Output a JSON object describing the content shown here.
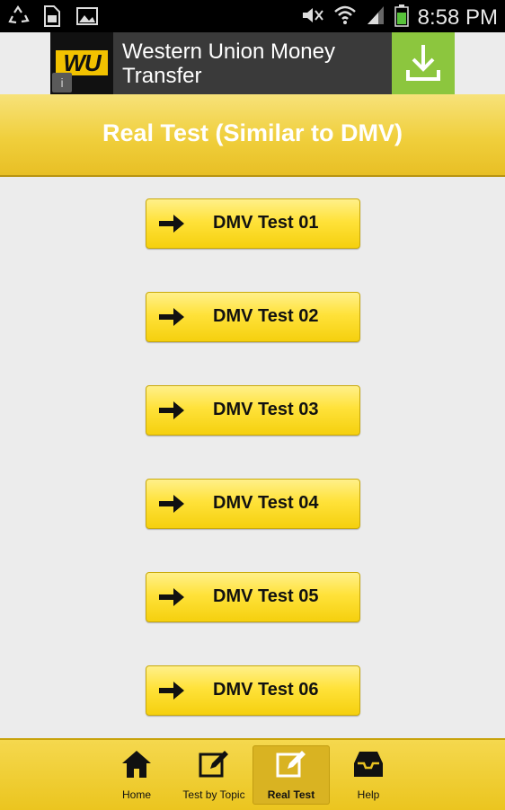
{
  "status_bar": {
    "time": "8:58 PM",
    "left_icons": [
      "recycle-icon",
      "sd-card-icon",
      "image-icon"
    ],
    "right_icons": [
      "mute-icon",
      "wifi-icon",
      "signal-icon",
      "battery-icon"
    ]
  },
  "ad": {
    "logo_text": "WU",
    "text": "Western Union Money Transfer",
    "info_icon": "info-icon",
    "download_icon": "download-icon",
    "colors": {
      "logo_yellow": "#f2c200",
      "download_green": "#8cc63e"
    }
  },
  "header": {
    "title": "Real Test (Similar to DMV)"
  },
  "tests": [
    {
      "label": "DMV Test 01",
      "icon": "arrow-right-icon"
    },
    {
      "label": "DMV Test 02",
      "icon": "arrow-right-icon"
    },
    {
      "label": "DMV Test 03",
      "icon": "arrow-right-icon"
    },
    {
      "label": "DMV Test 04",
      "icon": "arrow-right-icon"
    },
    {
      "label": "DMV Test 05",
      "icon": "arrow-right-icon"
    },
    {
      "label": "DMV Test 06",
      "icon": "arrow-right-icon"
    }
  ],
  "tabs": [
    {
      "label": "Home",
      "icon": "home-icon",
      "active": false
    },
    {
      "label": "Test by Topic",
      "icon": "edit-icon",
      "active": false
    },
    {
      "label": "Real Test",
      "icon": "edit-icon",
      "active": true
    },
    {
      "label": "Help",
      "icon": "inbox-icon",
      "active": false
    }
  ],
  "colors": {
    "accent_yellow": "#f0cf3c",
    "background": "#ececec"
  }
}
